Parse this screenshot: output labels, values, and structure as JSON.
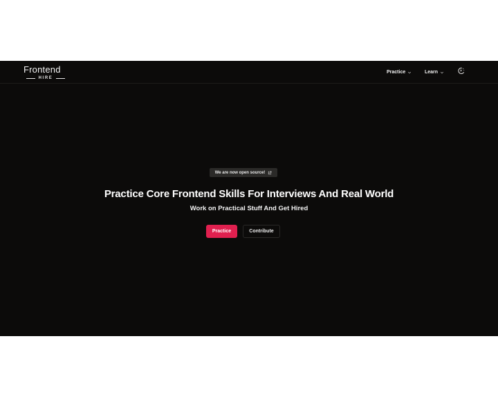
{
  "logo": {
    "main": "Frontend",
    "sub": "HIRE"
  },
  "nav": {
    "practice": "Practice",
    "learn": "Learn",
    "theme_toggle_icon": "moon-sun-icon"
  },
  "hero": {
    "badge": "We are now open source!",
    "badge_icon": "external-link-icon",
    "title": "Practice Core Frontend Skills For Interviews And Real World",
    "subtitle": "Work on Practical Stuff And Get Hired",
    "primary_button": "Practice",
    "secondary_button": "Contribute"
  },
  "colors": {
    "background": "#0c0b0a",
    "accent": "#e0204f",
    "badge_bg": "#2b2a28",
    "text": "#ffffff"
  }
}
